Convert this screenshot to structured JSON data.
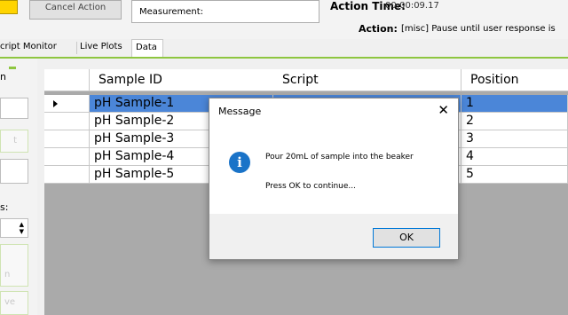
{
  "toolbar": {
    "cancel_action_label": "Cancel Action",
    "measurement_label": "Measurement:",
    "action_time_label": "Action Time:",
    "action_time_value": "00:00:09.17",
    "action_label": "Action:",
    "action_value": "[misc] Pause until user response is"
  },
  "tabs": [
    "cript Monitor",
    "Live Plots",
    "Data"
  ],
  "left_panel": {
    "heading_fragment": "n",
    "box_fragment": "t",
    "label_fragment": "s:",
    "box2_fragment": "n",
    "box3_fragment": "ve"
  },
  "grid": {
    "columns": [
      "Sample ID",
      "Script",
      "Position"
    ],
    "rows": [
      {
        "sample_id": "pH Sample-1",
        "script": "",
        "position": "1",
        "selected": true
      },
      {
        "sample_id": "pH Sample-2",
        "script": "",
        "position": "2"
      },
      {
        "sample_id": "pH Sample-3",
        "script": "",
        "position": "3"
      },
      {
        "sample_id": "pH Sample-4",
        "script": "",
        "position": "4"
      },
      {
        "sample_id": "pH Sample-5",
        "script": "",
        "position": "5"
      }
    ]
  },
  "dialog": {
    "title": "Message",
    "close_glyph": "✕",
    "icon": "info-icon",
    "message": "Pour 20mL of sample into the beaker",
    "prompt": "Press OK to continue...",
    "ok_label": "OK"
  },
  "colors": {
    "accent_green": "#8ec640",
    "selection_blue": "#4b86d8",
    "info_blue": "#1a73c8",
    "yellow": "#ffd400"
  }
}
